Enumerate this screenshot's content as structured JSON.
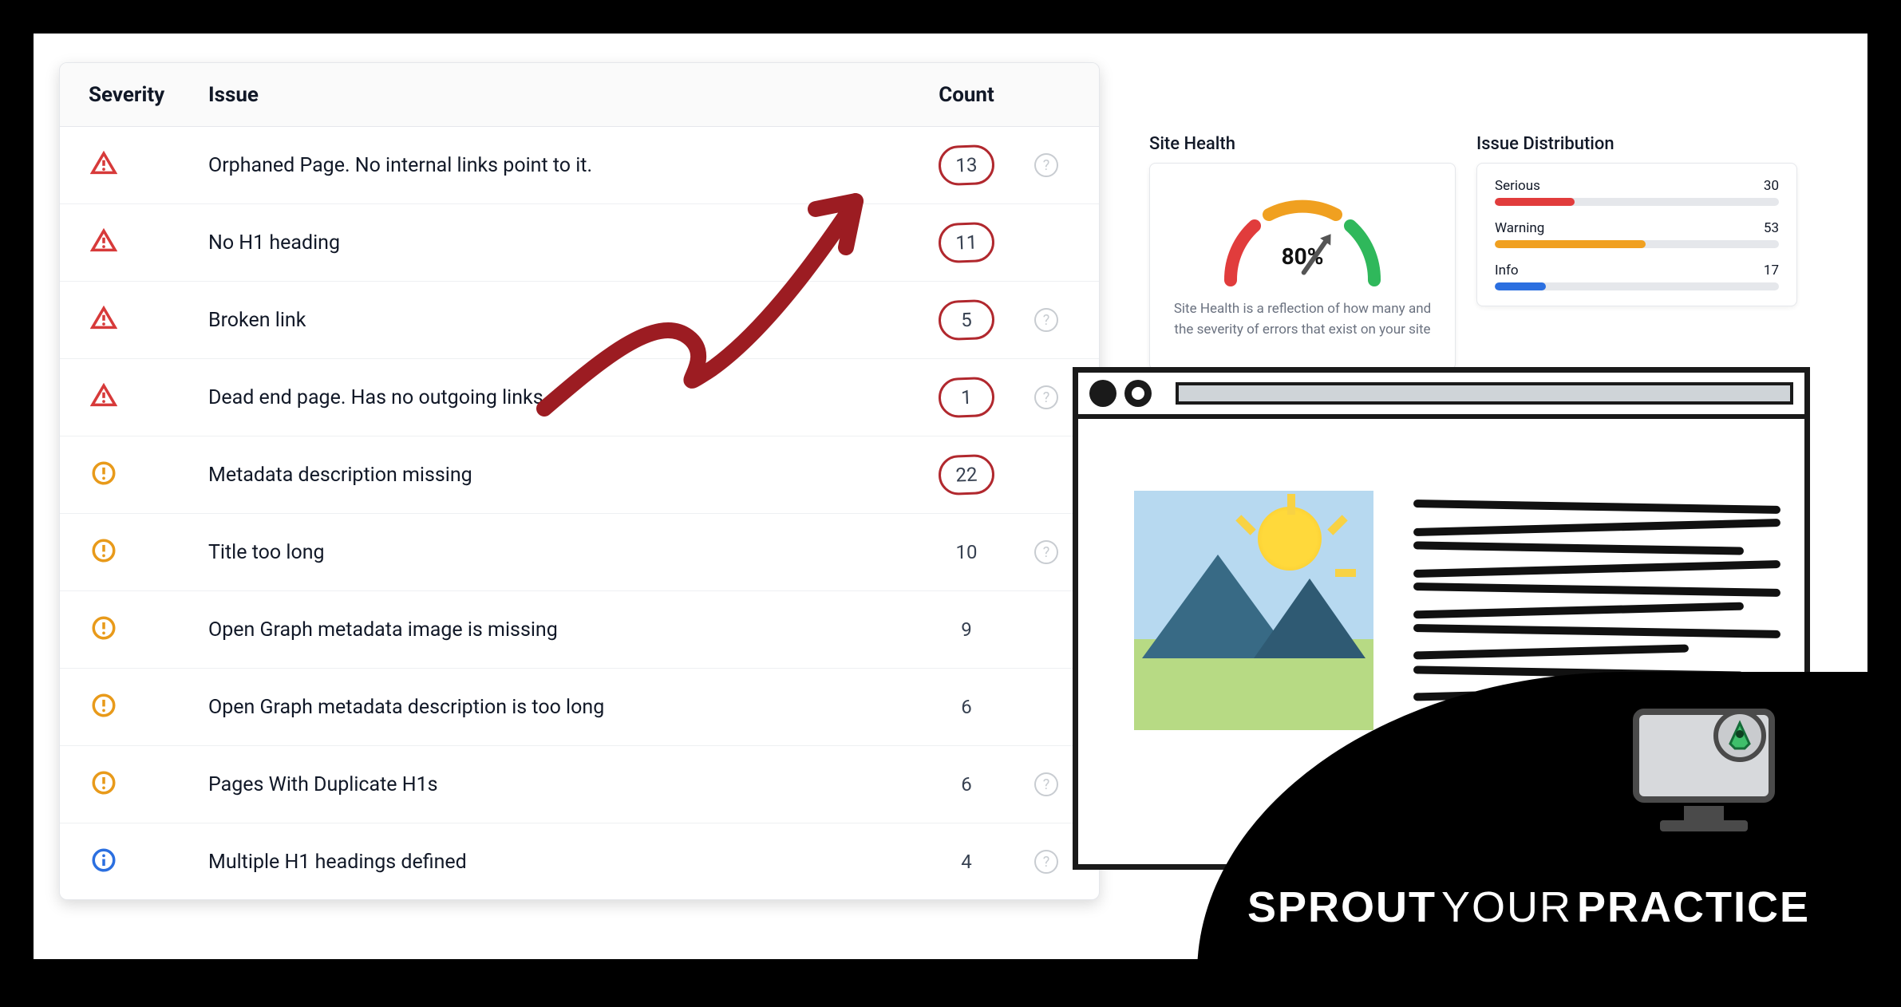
{
  "table": {
    "headers": {
      "severity": "Severity",
      "issue": "Issue",
      "count": "Count"
    },
    "rows": [
      {
        "severity": "serious",
        "issue": "Orphaned Page. No internal links point to it.",
        "count": 13,
        "highlighted": true,
        "help": true
      },
      {
        "severity": "serious",
        "issue": "No H1 heading",
        "count": 11,
        "highlighted": true,
        "help": false
      },
      {
        "severity": "serious",
        "issue": "Broken link",
        "count": 5,
        "highlighted": true,
        "help": true
      },
      {
        "severity": "serious",
        "issue": "Dead end page. Has no outgoing links.",
        "count": 1,
        "highlighted": true,
        "help": true
      },
      {
        "severity": "warning",
        "issue": "Metadata description missing",
        "count": 22,
        "highlighted": true,
        "help": false
      },
      {
        "severity": "warning",
        "issue": "Title too long",
        "count": 10,
        "highlighted": false,
        "help": true
      },
      {
        "severity": "warning",
        "issue": "Open Graph metadata image is missing",
        "count": 9,
        "highlighted": false,
        "help": false
      },
      {
        "severity": "warning",
        "issue": "Open Graph metadata description is too long",
        "count": 6,
        "highlighted": false,
        "help": false
      },
      {
        "severity": "warning",
        "issue": "Pages With Duplicate H1s",
        "count": 6,
        "highlighted": false,
        "help": true
      },
      {
        "severity": "info",
        "issue": "Multiple H1 headings defined",
        "count": 4,
        "highlighted": false,
        "help": true
      }
    ]
  },
  "site_health": {
    "title": "Site Health",
    "percent": "80%",
    "caption": "Site Health is a reflection of how many and the severity of errors that exist on your site"
  },
  "issue_distribution": {
    "title": "Issue Distribution",
    "items": [
      {
        "label": "Serious",
        "count": 30,
        "pct": 28,
        "class": "fill-serious"
      },
      {
        "label": "Warning",
        "count": 53,
        "pct": 53,
        "class": "fill-warning"
      },
      {
        "label": "Info",
        "count": 17,
        "pct": 18,
        "class": "fill-info"
      }
    ]
  },
  "brand": {
    "a": "SPROUT",
    "b": "YOUR",
    "c": "PRACTICE"
  },
  "colors": {
    "serious": "#d73a3a",
    "warning": "#e89a1a",
    "info": "#2b6fe0",
    "highlight": "#b1282e"
  }
}
